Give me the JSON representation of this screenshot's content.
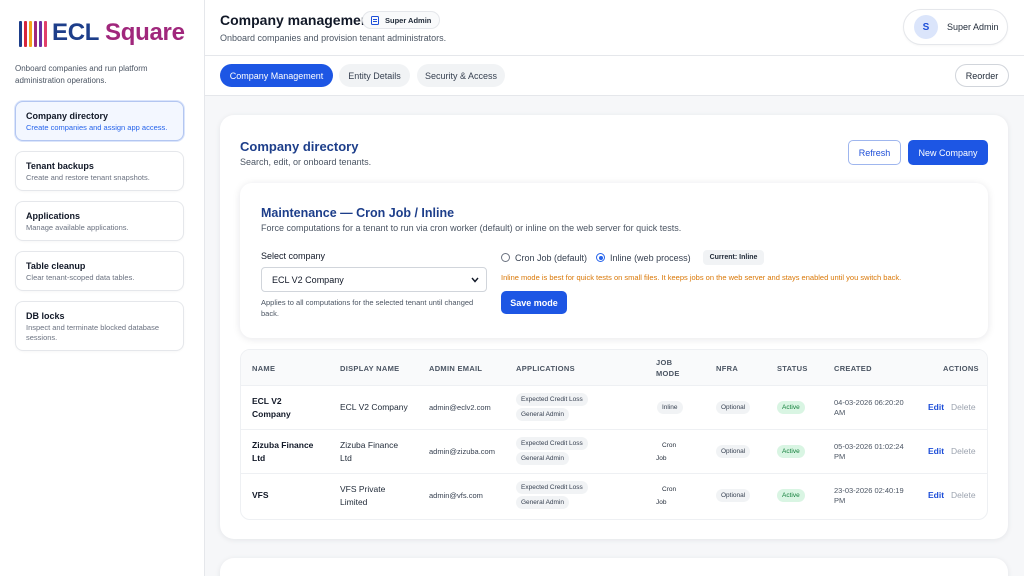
{
  "app": {
    "logo_ecl": "ECL",
    "logo_square": "Square"
  },
  "sidebar": {
    "description": "Onboard companies and run platform administration operations.",
    "items": [
      {
        "title": "Company directory",
        "subtitle": "Create companies and assign app access."
      },
      {
        "title": "Tenant backups",
        "subtitle": "Create and restore tenant snapshots."
      },
      {
        "title": "Applications",
        "subtitle": "Manage available applications."
      },
      {
        "title": "Table cleanup",
        "subtitle": "Clear tenant-scoped data tables."
      },
      {
        "title": "DB locks",
        "subtitle": "Inspect and terminate blocked database sessions."
      }
    ]
  },
  "header": {
    "title": "Company management",
    "role_badge": "Super Admin",
    "subtitle": "Onboard companies and provision tenant administrators.",
    "user_initial": "S",
    "user_name": "Super Admin"
  },
  "tabs": [
    {
      "label": "Company Management"
    },
    {
      "label": "Entity Details"
    },
    {
      "label": "Security & Access"
    }
  ],
  "reorder_label": "Reorder",
  "directory": {
    "title": "Company directory",
    "subtitle": "Search, edit, or onboard tenants.",
    "refresh_label": "Refresh",
    "new_label": "New Company"
  },
  "maintenance": {
    "title": "Maintenance — Cron Job / Inline",
    "subtitle": "Force computations for a tenant to run via cron worker (default) or inline on the web server for quick tests.",
    "select_label": "Select company",
    "selected_company": "ECL V2 Company",
    "help": "Applies to all computations for the selected tenant until changed back.",
    "option_cron": "Cron Job (default)",
    "option_inline": "Inline (web process)",
    "selected_mode": "inline",
    "current_badge": "Current: Inline",
    "warning": "Inline mode is best for quick tests on small files. It keeps jobs on the web server and stays enabled until you switch back.",
    "save_label": "Save mode"
  },
  "table": {
    "headers": {
      "name": "NAME",
      "display_name": "DISPLAY NAME",
      "admin_email": "ADMIN EMAIL",
      "applications": "APPLICATIONS",
      "job_mode_1": "JOB",
      "job_mode_2": "MODE",
      "nfra": "NFRA",
      "status": "STATUS",
      "created": "CREATED",
      "actions": "ACTIONS"
    },
    "rows": [
      {
        "name_1": "ECL V2",
        "name_2": "Company",
        "display_1": "ECL V2 Company",
        "display_2": "",
        "email": "admin@eclv2.com",
        "app_1": "Expected Credit Loss",
        "app_2": "General Admin",
        "job_1": "Inline",
        "job_2": "",
        "nfra": "Optional",
        "status": "Active",
        "created_1": "04-03-2026 06:20:20",
        "created_2": "AM",
        "edit": "Edit",
        "delete": "Delete"
      },
      {
        "name_1": "Zizuba Finance",
        "name_2": "Ltd",
        "display_1": "Zizuba Finance",
        "display_2": "Ltd",
        "email": "admin@zizuba.com",
        "app_1": "Expected Credit Loss",
        "app_2": "General Admin",
        "job_1": "Cron",
        "job_2": "Job",
        "nfra": "Optional",
        "status": "Active",
        "created_1": "05-03-2026 01:02:24",
        "created_2": "PM",
        "edit": "Edit",
        "delete": "Delete"
      },
      {
        "name_1": "VFS",
        "name_2": "",
        "display_1": "VFS Private",
        "display_2": "Limited",
        "email": "admin@vfs.com",
        "app_1": "Expected Credit Loss",
        "app_2": "General Admin",
        "job_1": "Cron",
        "job_2": "Job",
        "nfra": "Optional",
        "status": "Active",
        "created_1": "23-03-2026 02:40:19",
        "created_2": "PM",
        "edit": "Edit",
        "delete": "Delete"
      }
    ]
  },
  "colors": {
    "primary": "#1d56e4",
    "brand_navy": "#1d3e8a",
    "brand_magenta": "#a0277c",
    "warning": "#d97706",
    "success": "#15803d"
  }
}
